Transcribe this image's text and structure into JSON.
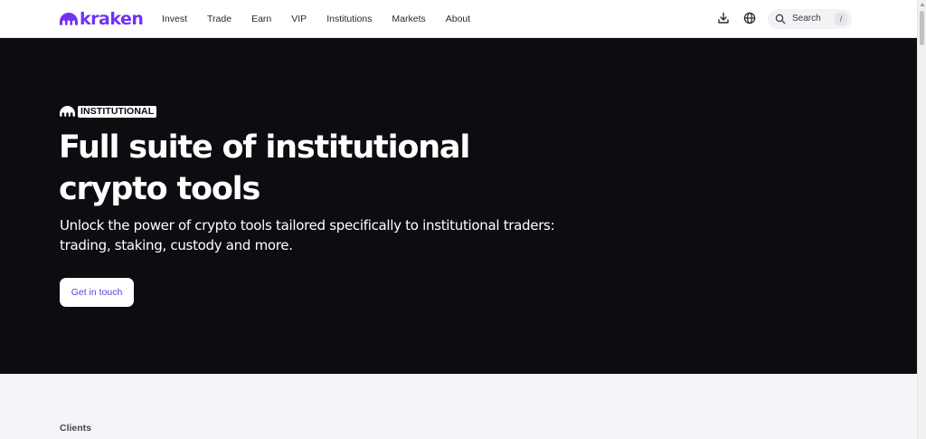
{
  "header": {
    "logo_text": "kraken",
    "nav": [
      "Invest",
      "Trade",
      "Earn",
      "VIP",
      "Institutions",
      "Markets",
      "About"
    ],
    "search_label": "Search",
    "search_shortcut": "/",
    "icons": [
      "download-icon",
      "globe-icon",
      "search-icon"
    ]
  },
  "hero": {
    "badge": "INSTITUTIONAL",
    "title_line1": "Full suite of institutional",
    "title_line2": "crypto tools",
    "subtitle_line1": "Unlock the power of crypto tools tailored specifically to institutional traders:",
    "subtitle_line2": "trading, staking, custody and more.",
    "cta": "Get in touch"
  },
  "lower": {
    "clients_label": "Clients"
  },
  "colors": {
    "brand": "#7132f5",
    "hero_bg": "#0e0c11",
    "cta_text": "#5741d9",
    "lower_bg": "#f5f4f8"
  }
}
